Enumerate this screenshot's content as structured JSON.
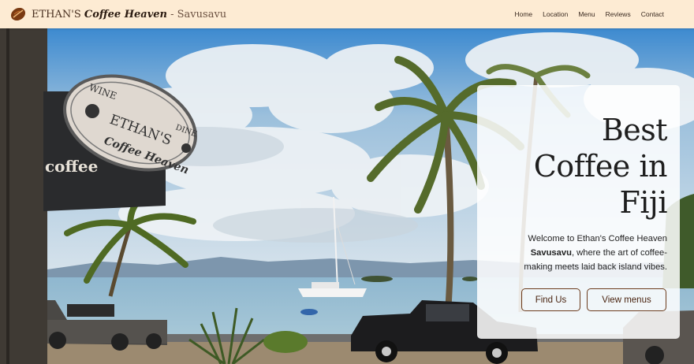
{
  "nav": {
    "brand_prefix": "ETHAN'S",
    "brand_fancy": "Coffee Heaven",
    "brand_suffix": "- Savusavu",
    "links": [
      "Home",
      "Location",
      "Menu",
      "Reviews",
      "Contact"
    ]
  },
  "hero": {
    "sign_top_left": "WINE",
    "sign_top_right": "DINE",
    "sign_name": "ETHAN'S",
    "sign_sub": "Coffee Heaven",
    "awning_text": "coffee"
  },
  "card": {
    "title_line1": "Best",
    "title_line2": "Coffee in",
    "title_line3": "Fiji",
    "text_before": "Welcome to Ethan's Coffee Heaven",
    "text_bold": "Savusavu",
    "text_after": ", where the art of coffee-making meets laid back island vibes.",
    "button_find": "Find Us",
    "button_menu": "View menus"
  },
  "colors": {
    "nav_bg": "#fdebd3",
    "button_border": "#6b3b1c",
    "brand_dark": "#2a1a10"
  }
}
